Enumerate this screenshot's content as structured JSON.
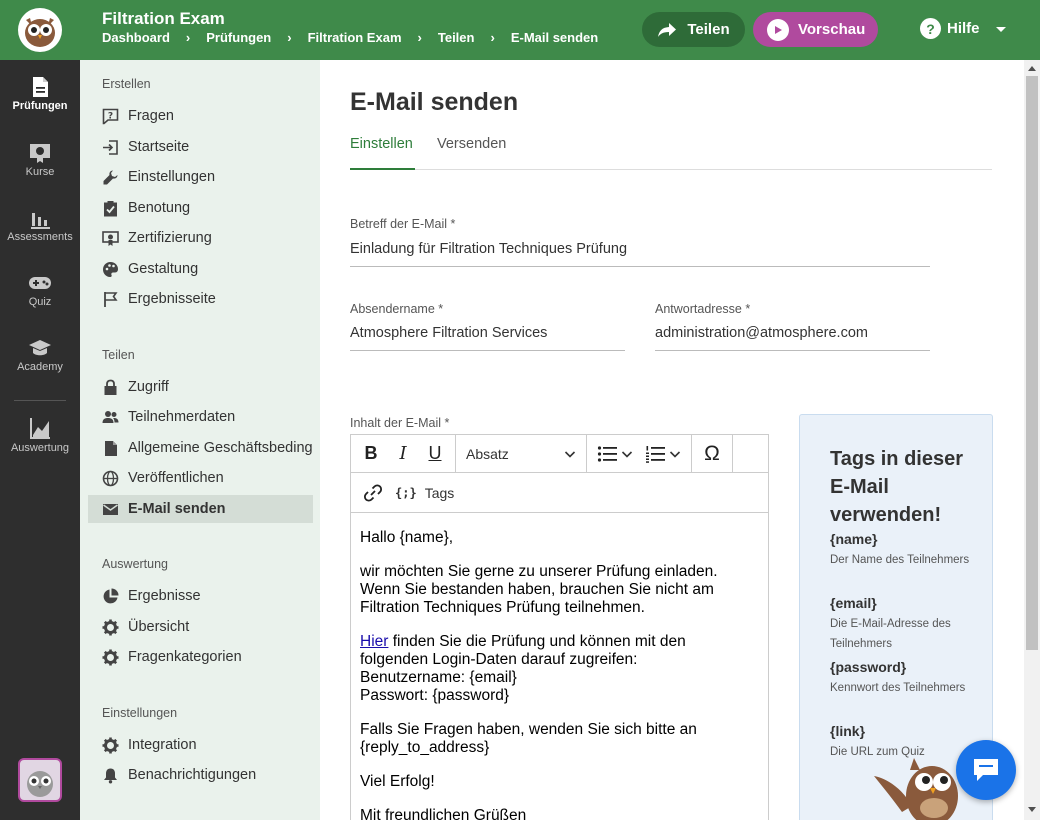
{
  "header": {
    "title": "Filtration Exam",
    "breadcrumbs": [
      "Dashboard",
      "Prüfungen",
      "Filtration Exam",
      "Teilen",
      "E-Mail senden"
    ],
    "breadcrumb_sep": "›",
    "share_label": "Teilen",
    "preview_label": "Vorschau",
    "help_label": "Hilfe",
    "help_symbol": "?",
    "colors": {
      "bar": "#3f8a4a",
      "share": "#2e6b38",
      "preview": "#b04a9e"
    }
  },
  "rail": {
    "items": [
      {
        "label": "Prüfungen",
        "icon": "document-icon",
        "active": true
      },
      {
        "label": "Kurse",
        "icon": "certificate-icon",
        "active": false
      },
      {
        "label": "Assessments",
        "icon": "bar-chart-icon",
        "active": false
      },
      {
        "label": "Quiz",
        "icon": "gamepad-icon",
        "active": false
      },
      {
        "label": "Academy",
        "icon": "graduation-cap-icon",
        "active": false
      },
      {
        "label": "Auswertung",
        "icon": "line-chart-icon",
        "active": false
      }
    ]
  },
  "sidebar": {
    "sections": [
      {
        "heading": "Erstellen",
        "items": [
          {
            "label": "Fragen",
            "icon": "question-box-icon"
          },
          {
            "label": "Startseite",
            "icon": "enter-icon"
          },
          {
            "label": "Einstellungen",
            "icon": "wrench-icon"
          },
          {
            "label": "Benotung",
            "icon": "clipboard-check-icon"
          },
          {
            "label": "Zertifizierung",
            "icon": "certificate-icon"
          },
          {
            "label": "Gestaltung",
            "icon": "palette-icon"
          },
          {
            "label": "Ergebnisseite",
            "icon": "flag-icon"
          }
        ]
      },
      {
        "heading": "Teilen",
        "items": [
          {
            "label": "Zugriff",
            "icon": "lock-icon"
          },
          {
            "label": "Teilnehmerdaten",
            "icon": "people-icon"
          },
          {
            "label": "Allgemeine Geschäftsbedingungen",
            "icon": "file-icon"
          },
          {
            "label": "Veröffentlichen",
            "icon": "globe-icon"
          },
          {
            "label": "E-Mail senden",
            "icon": "mail-icon",
            "active": true
          }
        ]
      },
      {
        "heading": "Auswertung",
        "items": [
          {
            "label": "Ergebnisse",
            "icon": "pie-icon"
          },
          {
            "label": "Übersicht",
            "icon": "gear-icon"
          },
          {
            "label": "Fragenkategorien",
            "icon": "gear-icon"
          }
        ]
      },
      {
        "heading": "Einstellungen",
        "items": [
          {
            "label": "Integration",
            "icon": "gear-icon"
          },
          {
            "label": "Benachrichtigungen",
            "icon": "bell-icon"
          }
        ]
      }
    ]
  },
  "main": {
    "title": "E-Mail senden",
    "tabs": [
      {
        "label": "Einstellen",
        "active": true
      },
      {
        "label": "Versenden",
        "active": false
      }
    ],
    "subject": {
      "label": "Betreff der E-Mail *",
      "value": "Einladung für Filtration Techniques Prüfung"
    },
    "sender": {
      "label": "Absendername *",
      "value": "Atmosphere Filtration Services"
    },
    "reply": {
      "label": "Antwortadresse *",
      "value": "administration@atmosphere.com"
    },
    "content_label": "Inhalt der E-Mail *"
  },
  "editor": {
    "bold": "B",
    "italic": "I",
    "underline": "U",
    "paragraph_select": "Absatz",
    "omega": "Ω",
    "tags_button": "Tags",
    "tags_glyph": "{;}",
    "body": {
      "greeting": "Hallo {name},",
      "invite": [
        "wir möchten Sie gerne zu unserer Prüfung einladen.",
        "Wenn Sie bestanden haben, brauchen Sie nicht am",
        "Filtration Techniques Prüfung teilnehmen."
      ],
      "link_text": "Hier",
      "link_rest": " finden Sie die Prüfung und können mit den",
      "login": [
        "folgenden Login-Daten darauf zugreifen:",
        "Benutzername: {email}",
        "Passwort: {password}"
      ],
      "questions": [
        "Falls Sie Fragen haben, wenden Sie sich bitte an",
        "{reply_to_address}"
      ],
      "luck": "Viel Erfolg!",
      "closing": "Mit freundlichen Grüßen"
    }
  },
  "tags_panel": {
    "title": "Tags in dieser E-Mail verwenden!",
    "tags": [
      {
        "name": "{name}",
        "desc": "Der Name des Teilnehmers"
      },
      {
        "name": "{email}",
        "desc": "Die E-Mail-Adresse des Teilnehmers"
      },
      {
        "name": "{password}",
        "desc": "Kennwort des Teilnehmers"
      },
      {
        "name": "{link}",
        "desc": "Die URL zum Quiz"
      }
    ]
  }
}
